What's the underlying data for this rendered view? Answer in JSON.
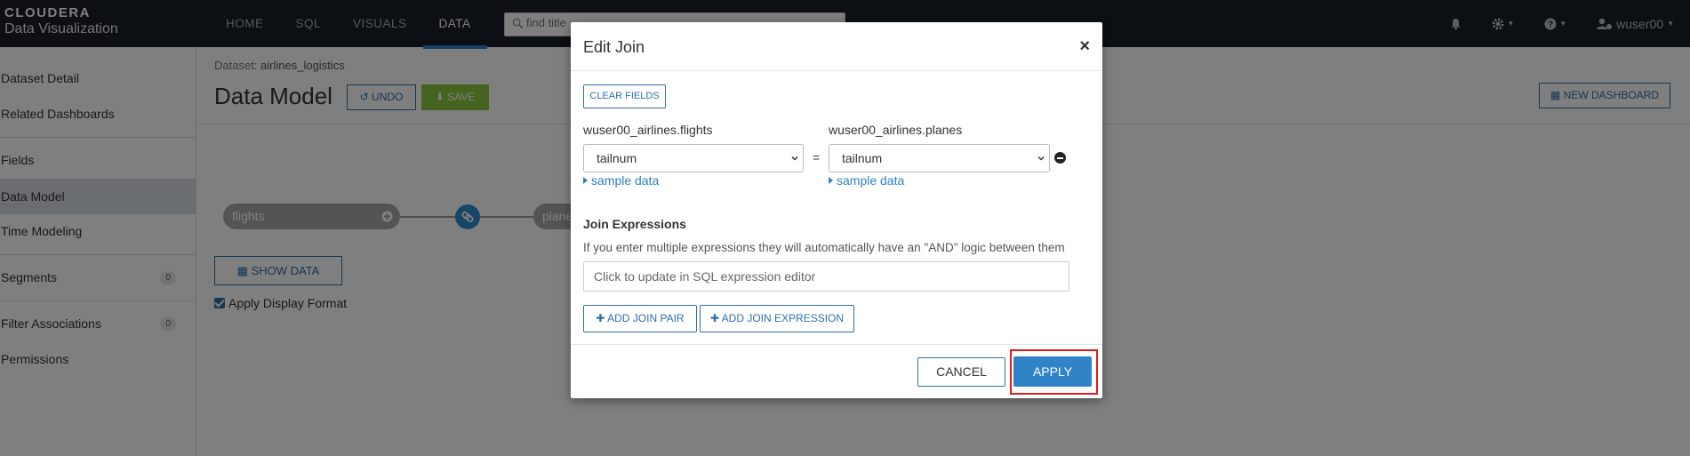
{
  "brand": {
    "line1": "CLOUDERA",
    "line2": "Data Visualization"
  },
  "nav": [
    {
      "label": "HOME"
    },
    {
      "label": "SQL"
    },
    {
      "label": "VISUALS"
    },
    {
      "label": "DATA",
      "active": true
    }
  ],
  "search": {
    "placeholder": "find title",
    "value": ""
  },
  "user": {
    "name": "wuser00"
  },
  "sidebar": {
    "items": [
      {
        "label": "Dataset Detail"
      },
      {
        "label": "Related Dashboards"
      },
      {
        "label": "Fields"
      },
      {
        "label": "Data Model",
        "active": true
      },
      {
        "label": "Time Modeling"
      },
      {
        "label": "Segments",
        "count": "0"
      },
      {
        "label": "Filter Associations",
        "count": "0"
      },
      {
        "label": "Permissions"
      }
    ]
  },
  "main": {
    "breadcrumb_prefix": "Dataset:",
    "breadcrumb_value": "airlines_logistics",
    "title": "Data Model",
    "undo_label": "UNDO",
    "save_label": "SAVE",
    "new_dashboard_label": "NEW DASHBOARD",
    "node_left": "flights",
    "node_right": "plane",
    "show_data_label": "SHOW DATA",
    "apply_format_label": "Apply Display Format",
    "apply_format_checked": true
  },
  "modal": {
    "title": "Edit Join",
    "clear_fields_label": "CLEAR FIELDS",
    "left_table": "wuser00_airlines.flights",
    "right_table": "wuser00_airlines.planes",
    "left_field": "tailnum",
    "right_field": "tailnum",
    "equals": "=",
    "sample_data_label": "sample data",
    "join_expressions_title": "Join Expressions",
    "join_expressions_help": "If you enter multiple expressions they will automatically have an \"AND\" logic between them",
    "expression_placeholder": "Click to update in SQL expression editor",
    "add_join_pair_label": "ADD JOIN PAIR",
    "add_join_expression_label": "ADD JOIN EXPRESSION",
    "cancel_label": "CANCEL",
    "apply_label": "APPLY"
  },
  "colors": {
    "accent": "#3183c8",
    "save": "#8cc63f",
    "highlight": "#e01b1b",
    "topbar": "#182029"
  }
}
